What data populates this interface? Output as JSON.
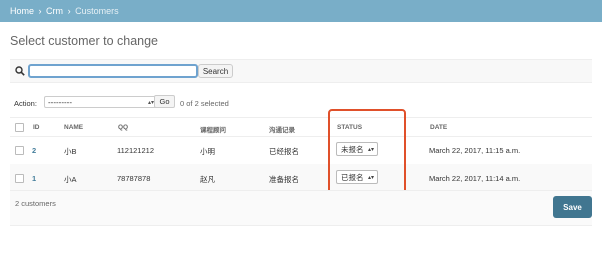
{
  "breadcrumb": {
    "home": "Home",
    "app": "Crm",
    "current": "Customers",
    "separator": "›"
  },
  "page": {
    "title": "Select customer to change"
  },
  "search": {
    "value": "",
    "button_label": "Search"
  },
  "actions": {
    "label": "Action:",
    "selected_option": "---------",
    "go_label": "Go",
    "selected_count": "0 of 2 selected"
  },
  "table": {
    "headers": [
      "ID",
      "NAME",
      "QQ",
      "课程顾问",
      "沟通记录",
      "STATUS",
      "DATE"
    ],
    "rows": [
      {
        "id": "2",
        "name": "小B",
        "qq": "112121212",
        "consultant": "小明",
        "record": "已经报名",
        "status": "未报名",
        "date": "March 22, 2017, 11:15 a.m."
      },
      {
        "id": "1",
        "name": "小A",
        "qq": "78787878",
        "consultant": "赵凡",
        "record": "准备报名",
        "status": "已报名",
        "date": "March 22, 2017, 11:14 a.m."
      }
    ]
  },
  "footer": {
    "count_text": "2 customers",
    "save_label": "Save"
  },
  "colors": {
    "topbar": "#79aec8",
    "save_button": "#417690",
    "highlight": "#e0502a",
    "link": "#447e9b"
  }
}
